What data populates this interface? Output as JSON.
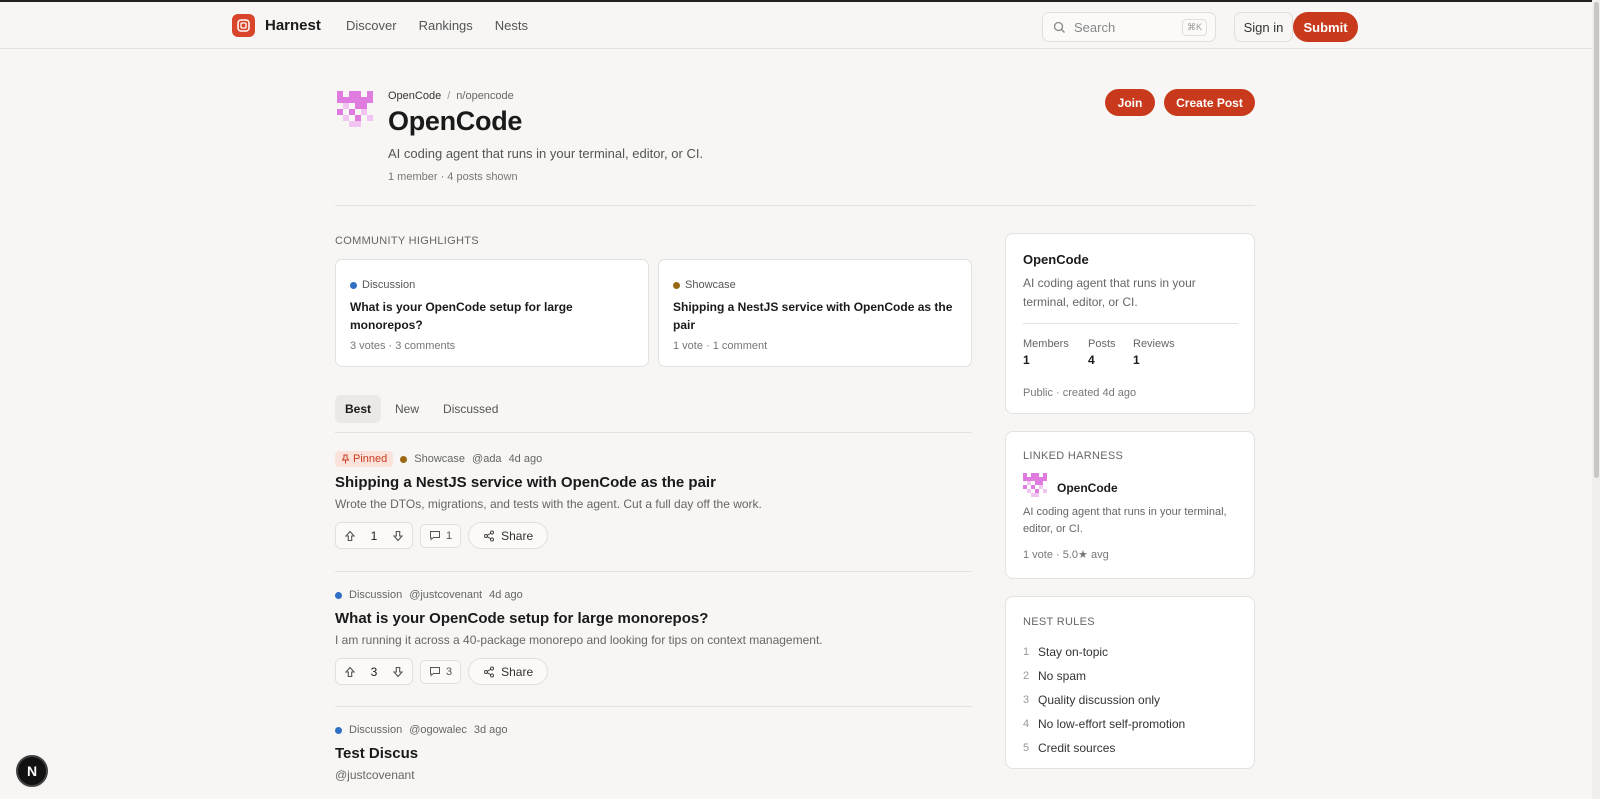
{
  "app": {
    "name": "Harnest"
  },
  "nav": [
    "Discover",
    "Rankings",
    "Nests"
  ],
  "search": {
    "placeholder": "Search",
    "shortcut": "⌘K"
  },
  "header": {
    "signin": "Sign in",
    "submit": "Submit"
  },
  "nest": {
    "breadcrumb": [
      "OpenCode",
      "n/opencode"
    ],
    "title": "OpenCode",
    "description": "AI coding agent that runs in your terminal, editor, or CI.",
    "meta": "1 member · 4 posts shown",
    "join": "Join",
    "create_post": "Create Post"
  },
  "highlights": {
    "label": "COMMUNITY HIGHLIGHTS",
    "cards": [
      {
        "category": "Discussion",
        "color": "#2f6fc4",
        "title": "What is your OpenCode setup for large monorepos?",
        "stats": "3 votes · 3 comments"
      },
      {
        "category": "Showcase",
        "color": "#9a6a12",
        "title": "Shipping a NestJS service with OpenCode as the pair",
        "stats": "1 vote · 1 comment"
      }
    ]
  },
  "tabs": [
    "Best",
    "New",
    "Discussed"
  ],
  "posts": [
    {
      "pinned": "Pinned",
      "category": "Showcase",
      "color": "#9a6a12",
      "author": "@ada",
      "time": "4d ago",
      "title": "Shipping a NestJS service with OpenCode as the pair",
      "excerpt": "Wrote the DTOs, migrations, and tests with the agent. Cut a full day off the work.",
      "votes": "1",
      "comments": "1",
      "share": "Share"
    },
    {
      "category": "Discussion",
      "color": "#2f6fc4",
      "author": "@justcovenant",
      "time": "4d ago",
      "title": "What is your OpenCode setup for large monorepos?",
      "excerpt": "I am running it across a 40-package monorepo and looking for tips on context management.",
      "votes": "3",
      "comments": "3",
      "share": "Share"
    },
    {
      "category": "Discussion",
      "color": "#2f6fc4",
      "author": "@ogowalec",
      "time": "3d ago",
      "title": "Test Discus",
      "excerpt": "@justcovenant"
    }
  ],
  "about": {
    "title": "OpenCode",
    "description": "AI coding agent that runs in your terminal, editor, or CI.",
    "stats": [
      {
        "label": "Members",
        "value": "1"
      },
      {
        "label": "Posts",
        "value": "4"
      },
      {
        "label": "Reviews",
        "value": "1"
      }
    ],
    "footer": "Public · created 4d ago"
  },
  "linked": {
    "label": "LINKED HARNESS",
    "name": "OpenCode",
    "description": "AI coding agent that runs in your terminal, editor, or CI.",
    "stats": "1 vote · 5.0★ avg"
  },
  "rules": {
    "label": "NEST RULES",
    "items": [
      "Stay on-topic",
      "No spam",
      "Quality discussion only",
      "No low-effort self-promotion",
      "Credit sources"
    ]
  },
  "badge": "N",
  "colors": {
    "accent": "#c93a1c",
    "nest_icon": "#e07be0"
  }
}
